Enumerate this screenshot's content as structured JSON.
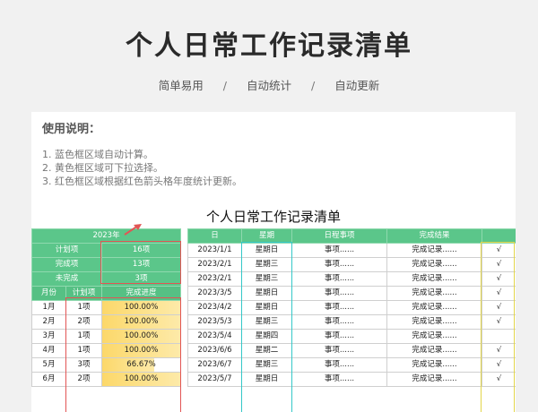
{
  "header": {
    "title": "个人日常工作记录清单",
    "taglines": [
      "简单易用",
      "自动统计",
      "自动更新"
    ],
    "separator": "/"
  },
  "usage": {
    "title": "使用说明：",
    "lines": [
      "1. 蓝色框区域自动计算。",
      "2. 黄色框区域可下拉选择。",
      "3. 红色框区域根据红色箭头格年度统计更新。"
    ]
  },
  "sheet_title": "个人日常工作记录清单",
  "summary": {
    "year": "2023年",
    "rows": [
      {
        "label": "计划项",
        "value": "16项"
      },
      {
        "label": "完成项",
        "value": "13项"
      },
      {
        "label": "未完成",
        "value": "3项"
      }
    ],
    "headers": [
      "月份",
      "计划项",
      "完成进度"
    ],
    "months": [
      {
        "month": "1月",
        "planned": "1项",
        "progress": "100.00%",
        "ratio": 1.0
      },
      {
        "month": "2月",
        "planned": "2项",
        "progress": "100.00%",
        "ratio": 1.0
      },
      {
        "month": "3月",
        "planned": "1项",
        "progress": "100.00%",
        "ratio": 1.0
      },
      {
        "month": "4月",
        "planned": "1项",
        "progress": "100.00%",
        "ratio": 1.0
      },
      {
        "month": "5月",
        "planned": "3项",
        "progress": "66.67%",
        "ratio": 0.6667
      },
      {
        "month": "6月",
        "planned": "2项",
        "progress": "100.00%",
        "ratio": 1.0
      }
    ]
  },
  "records": {
    "headers": [
      "日",
      "星期",
      "日程事项",
      "完成结果",
      ""
    ],
    "rows": [
      {
        "date": "2023/1/1",
        "weekday": "星期日",
        "item": "事项......",
        "result": "完成记录......",
        "check": "√"
      },
      {
        "date": "2023/2/1",
        "weekday": "星期三",
        "item": "事项......",
        "result": "完成记录......",
        "check": "√"
      },
      {
        "date": "2023/2/1",
        "weekday": "星期三",
        "item": "事项......",
        "result": "完成记录......",
        "check": "√"
      },
      {
        "date": "2023/3/5",
        "weekday": "星期日",
        "item": "事项......",
        "result": "完成记录......",
        "check": "√"
      },
      {
        "date": "2023/4/2",
        "weekday": "星期日",
        "item": "事项......",
        "result": "完成记录......",
        "check": "√"
      },
      {
        "date": "2023/5/3",
        "weekday": "星期三",
        "item": "事项......",
        "result": "完成记录......",
        "check": "√"
      },
      {
        "date": "2023/5/4",
        "weekday": "星期四",
        "item": "事项......",
        "result": "完成记录......",
        "check": ""
      },
      {
        "date": "2023/6/6",
        "weekday": "星期二",
        "item": "事项......",
        "result": "完成记录......",
        "check": "√"
      },
      {
        "date": "2023/6/7",
        "weekday": "星期三",
        "item": "事项......",
        "result": "完成记录......",
        "check": "√"
      },
      {
        "date": "2023/5/7",
        "weekday": "星期日",
        "item": "事项......",
        "result": "完成记录......",
        "check": "√"
      }
    ]
  },
  "colors": {
    "header_green": "#5bc68a",
    "red_frame": "#e25555",
    "cyan_frame": "#34c8c8",
    "yellow_frame": "#e3d64a"
  }
}
